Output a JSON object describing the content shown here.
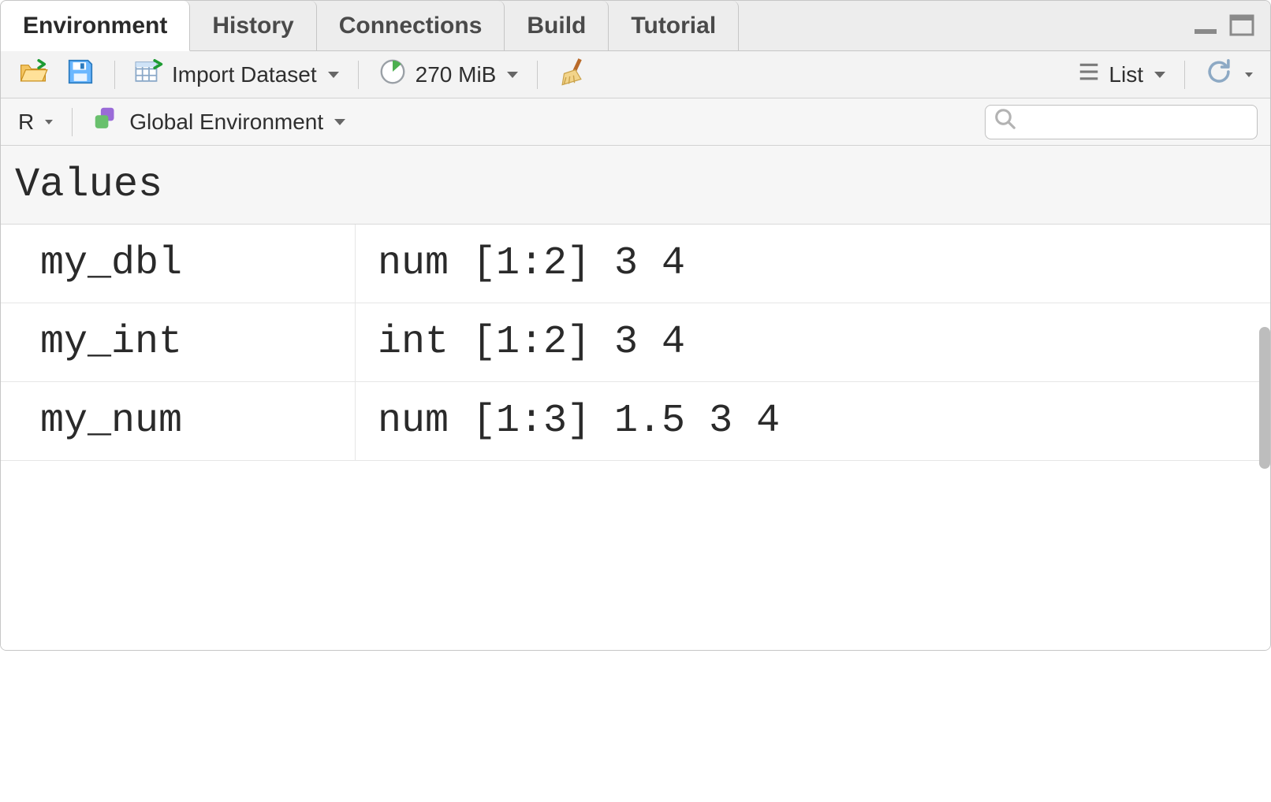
{
  "tabs": [
    {
      "label": "Environment",
      "active": true
    },
    {
      "label": "History",
      "active": false
    },
    {
      "label": "Connections",
      "active": false
    },
    {
      "label": "Build",
      "active": false
    },
    {
      "label": "Tutorial",
      "active": false
    }
  ],
  "toolbar1": {
    "import_label": "Import Dataset",
    "memory_label": "270 MiB",
    "view_mode_label": "List"
  },
  "toolbar2": {
    "language_label": "R",
    "scope_label": "Global Environment"
  },
  "search": {
    "placeholder": ""
  },
  "section_header": "Values",
  "values": [
    {
      "name": "my_dbl",
      "desc": "num [1:2] 3 4"
    },
    {
      "name": "my_int",
      "desc": "int [1:2] 3 4"
    },
    {
      "name": "my_num",
      "desc": "num [1:3] 1.5 3 4"
    }
  ]
}
